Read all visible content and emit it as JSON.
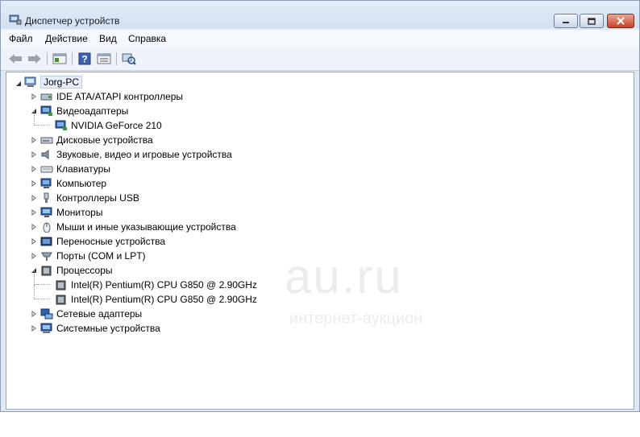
{
  "window": {
    "title": "Диспетчер устройств",
    "controls": {
      "minimize": "minimize",
      "maximize": "maximize",
      "close": "close"
    }
  },
  "menu": [
    "Файл",
    "Действие",
    "Вид",
    "Справка"
  ],
  "toolbar": [
    "back-icon",
    "forward-icon",
    "properties-icon",
    "help-icon",
    "details-icon",
    "scan-hardware-icon"
  ],
  "tree": {
    "root": "Jorg-PC",
    "categories": [
      {
        "label": "IDE ATA/ATAPI контроллеры",
        "expanded": false,
        "icon": "ide-controller-icon",
        "children": []
      },
      {
        "label": "Видеоадаптеры",
        "expanded": true,
        "icon": "display-adapter-icon",
        "children": [
          "NVIDIA GeForce 210"
        ]
      },
      {
        "label": "Дисковые устройства",
        "expanded": false,
        "icon": "disk-drive-icon",
        "children": []
      },
      {
        "label": "Звуковые, видео и игровые устройства",
        "expanded": false,
        "icon": "sound-icon",
        "children": []
      },
      {
        "label": "Клавиатуры",
        "expanded": false,
        "icon": "keyboard-icon",
        "children": []
      },
      {
        "label": "Компьютер",
        "expanded": false,
        "icon": "computer-icon",
        "children": []
      },
      {
        "label": "Контроллеры USB",
        "expanded": false,
        "icon": "usb-icon",
        "children": []
      },
      {
        "label": "Мониторы",
        "expanded": false,
        "icon": "monitor-icon",
        "children": []
      },
      {
        "label": "Мыши и иные указывающие устройства",
        "expanded": false,
        "icon": "mouse-icon",
        "children": []
      },
      {
        "label": "Переносные устройства",
        "expanded": false,
        "icon": "portable-device-icon",
        "children": []
      },
      {
        "label": "Порты (COM и LPT)",
        "expanded": false,
        "icon": "port-icon",
        "children": []
      },
      {
        "label": "Процессоры",
        "expanded": true,
        "icon": "processor-icon",
        "children": [
          "Intel(R) Pentium(R) CPU G850 @ 2.90GHz",
          "Intel(R) Pentium(R) CPU G850 @ 2.90GHz"
        ]
      },
      {
        "label": "Сетевые адаптеры",
        "expanded": false,
        "icon": "network-adapter-icon",
        "children": []
      },
      {
        "label": "Системные устройства",
        "expanded": false,
        "icon": "system-device-icon",
        "children": []
      }
    ]
  },
  "watermark": {
    "logo": "au.ru",
    "tagline": "интернет-аукцион"
  }
}
